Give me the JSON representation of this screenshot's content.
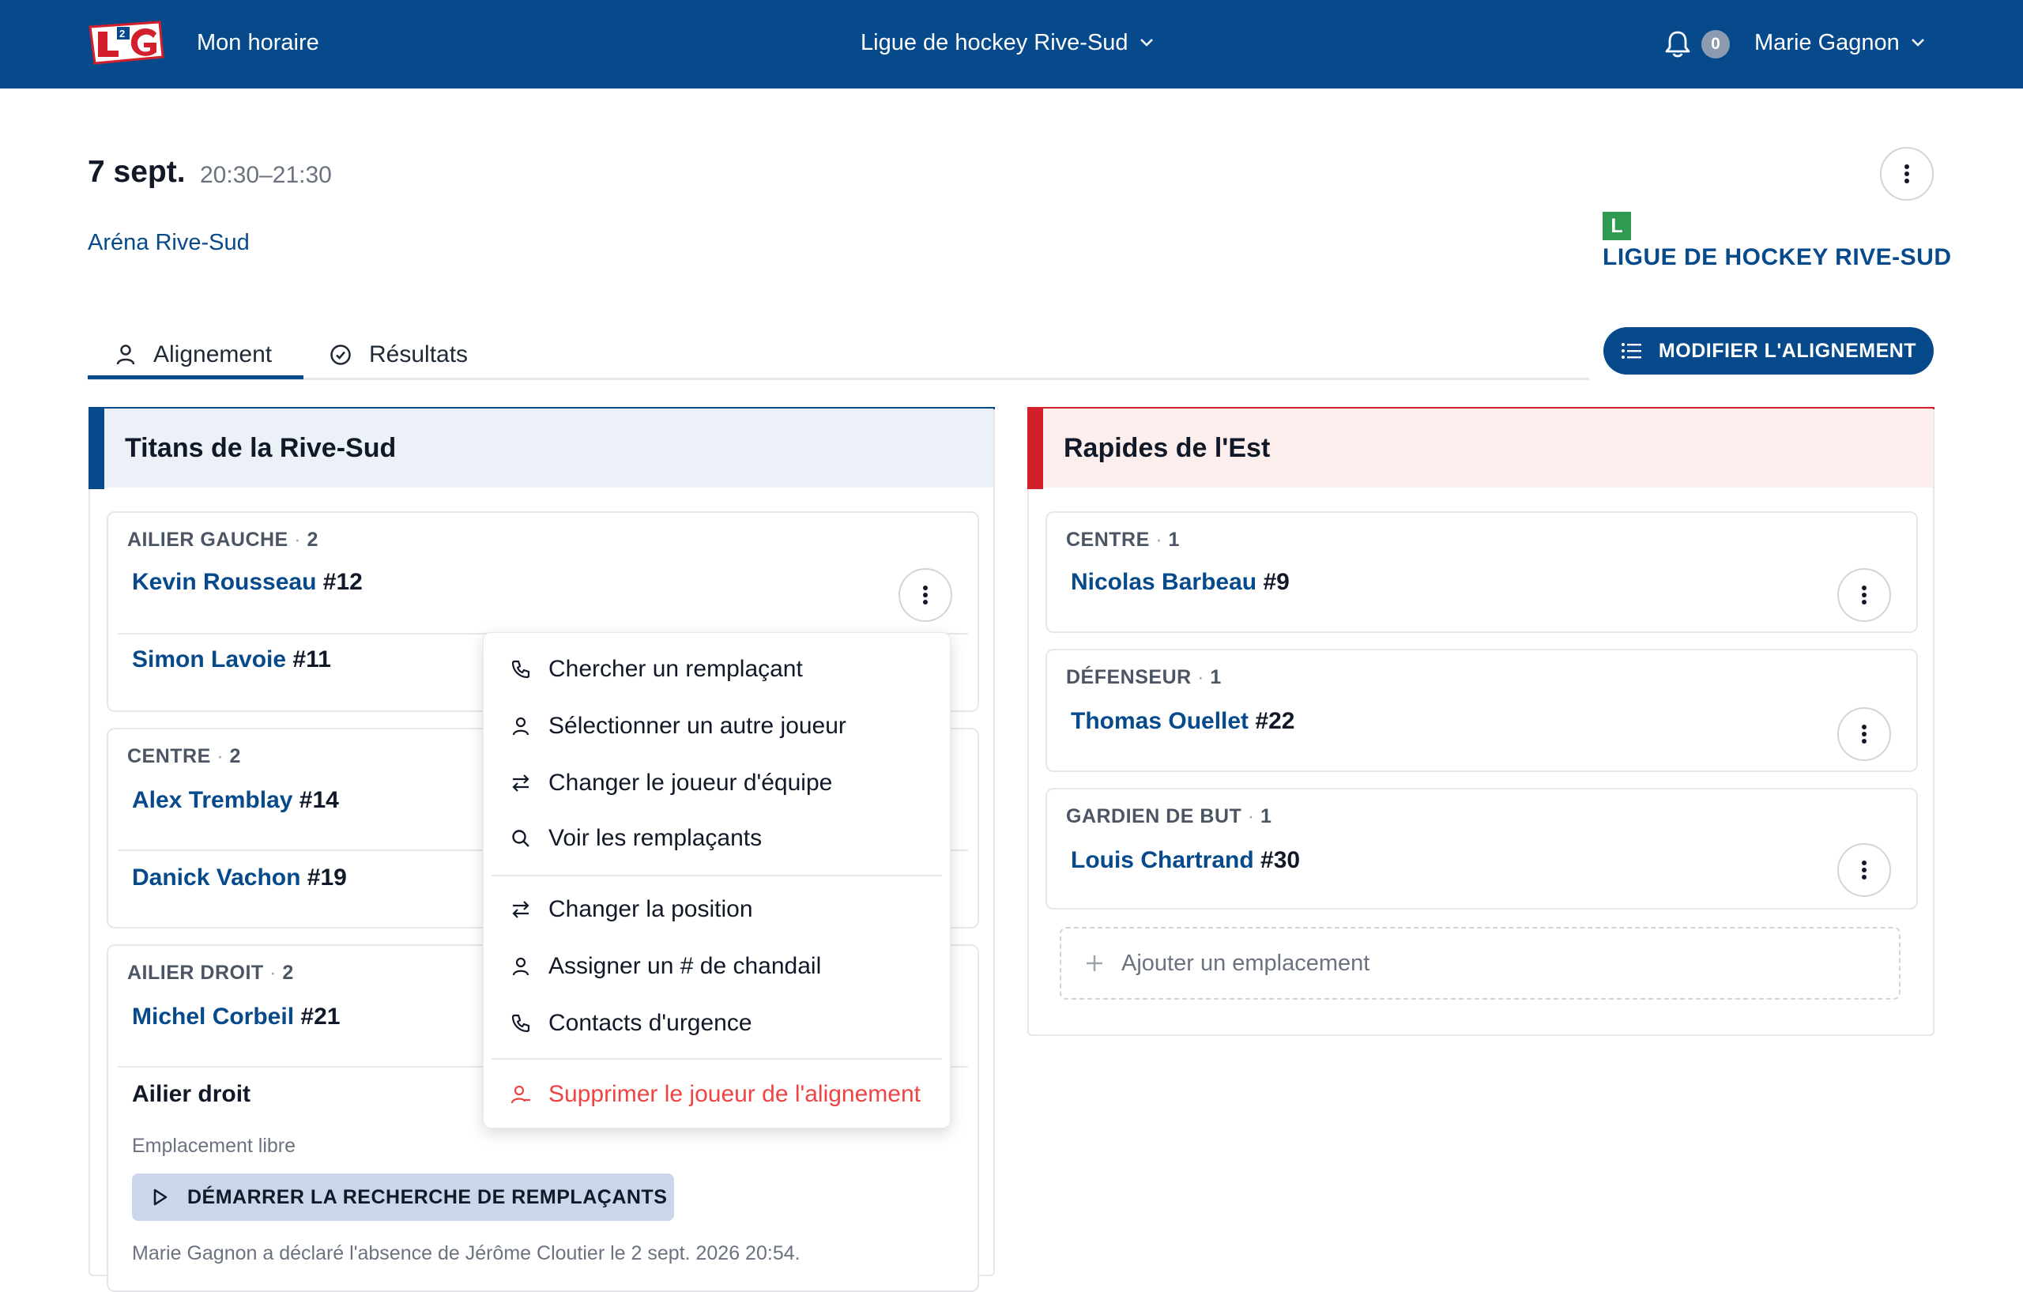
{
  "header": {
    "app_title": "Mon horaire",
    "league_selector": "Ligue de hockey Rive-Sud",
    "notifications_count": "0",
    "user_name": "Marie Gagnon",
    "logo_text": "L2G"
  },
  "event": {
    "date": "7 sept.",
    "time": "20:30–21:30",
    "venue": "Aréna Rive-Sud",
    "league_badge": "L",
    "league_name": "LIGUE DE HOCKEY RIVE-SUD"
  },
  "tabs": [
    {
      "label": "Alignement",
      "active": true
    },
    {
      "label": "Résultats",
      "active": false
    }
  ],
  "modify_button": "MODIFIER L'ALIGNEMENT",
  "colors": {
    "brand": "#064a8c",
    "home_accent": "#064a8c",
    "away_accent": "#d21f2b",
    "danger": "#ef4444",
    "league_badge": "#2e9a52"
  },
  "home_team": {
    "name": "Titans de la Rive-Sud",
    "positions": [
      {
        "label": "AILIER GAUCHE",
        "sep": "·",
        "count": "2",
        "players": [
          {
            "name": "Kevin Rousseau",
            "number": "#12"
          },
          {
            "name": "Simon Lavoie",
            "number": "#11"
          }
        ]
      },
      {
        "label": "CENTRE",
        "sep": "·",
        "count": "2",
        "players": [
          {
            "name": "Alex Tremblay",
            "number": "#14"
          },
          {
            "name": "Danick Vachon",
            "number": "#19"
          }
        ]
      },
      {
        "label": "AILIER DROIT",
        "sep": "·",
        "count": "2",
        "players": [
          {
            "name": "Michel Corbeil",
            "number": "#21"
          }
        ],
        "free_slot": {
          "title": "Ailier droit",
          "subtitle": "Emplacement libre",
          "button": "DÉMARRER LA RECHERCHE DE REMPLAÇANTS",
          "note": "Marie Gagnon a déclaré l'absence de Jérôme Cloutier le 2 sept. 2026 20:54."
        }
      }
    ]
  },
  "away_team": {
    "name": "Rapides de l'Est",
    "positions": [
      {
        "label": "CENTRE",
        "sep": "·",
        "count": "1",
        "players": [
          {
            "name": "Nicolas Barbeau",
            "number": "#9"
          }
        ]
      },
      {
        "label": "DÉFENSEUR",
        "sep": "·",
        "count": "1",
        "players": [
          {
            "name": "Thomas Ouellet",
            "number": "#22"
          }
        ]
      },
      {
        "label": "GARDIEN DE BUT",
        "sep": "·",
        "count": "1",
        "players": [
          {
            "name": "Louis Chartrand",
            "number": "#30"
          }
        ]
      }
    ],
    "add_slot": "Ajouter un emplacement"
  },
  "context_menu": {
    "items": [
      {
        "label": "Chercher un remplaçant",
        "icon": "phone-icon"
      },
      {
        "label": "Sélectionner un autre joueur",
        "icon": "person-icon"
      },
      {
        "label": "Changer le joueur d'équipe",
        "icon": "swap-icon"
      },
      {
        "label": "Voir les remplaçants",
        "icon": "search-icon"
      },
      {
        "label": "Changer la position",
        "icon": "swap-icon"
      },
      {
        "label": "Assigner un # de chandail",
        "icon": "person-icon"
      },
      {
        "label": "Contacts d'urgence",
        "icon": "phone-icon"
      },
      {
        "label": "Supprimer le joueur de l'alignement",
        "icon": "person-remove-icon"
      }
    ]
  }
}
